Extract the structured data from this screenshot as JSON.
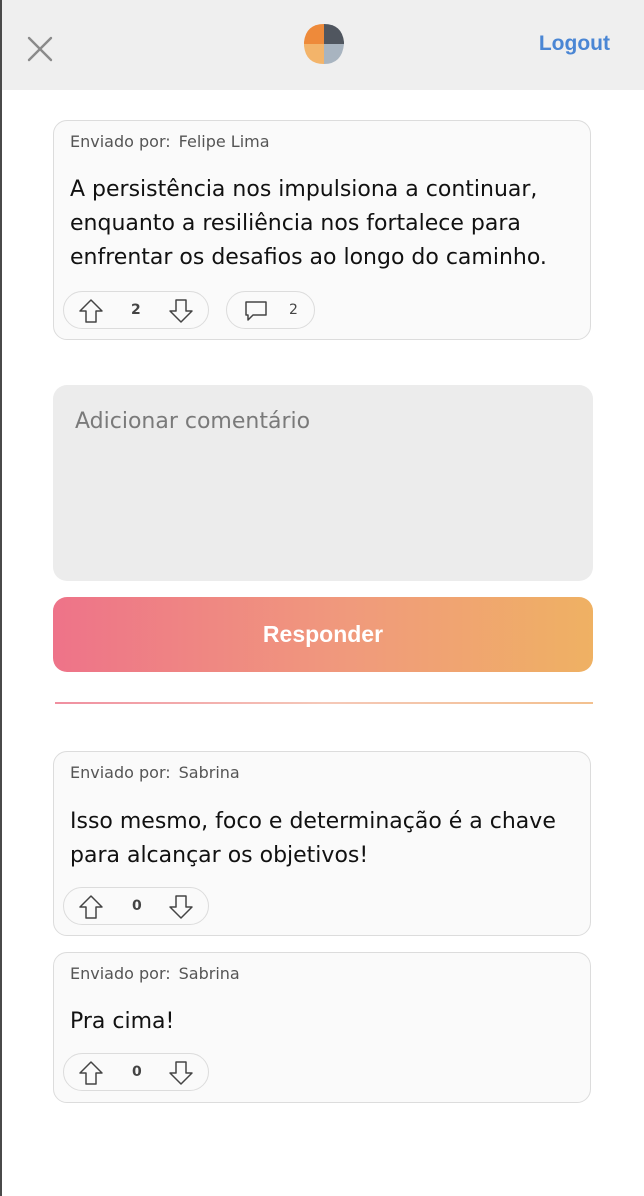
{
  "header": {
    "logout_label": "Logout"
  },
  "post": {
    "sent_by_label": "Enviado por:",
    "author": "Felipe Lima",
    "text": "A persistência nos impulsiona a continuar, enquanto a resiliência nos fortalece para enfrentar os desafios ao longo do caminho.",
    "votes": "2",
    "comments": "2"
  },
  "composer": {
    "placeholder": "Adicionar comentário",
    "reply_label": "Responder"
  },
  "replies": [
    {
      "sent_by_label": "Enviado por:",
      "author": "Sabrina",
      "text": "Isso mesmo, foco e determinação é a chave para alcançar os objetivos!",
      "votes": "0"
    },
    {
      "sent_by_label": "Enviado por:",
      "author": "Sabrina",
      "text": "Pra cima!",
      "votes": "0"
    }
  ],
  "colors": {
    "accent_link": "#4a86d4",
    "button_gradient_start": "#ee7389",
    "button_gradient_end": "#efb163"
  },
  "icons": [
    "close-icon",
    "app-logo",
    "upvote-arrow-icon",
    "downvote-arrow-icon",
    "comment-bubble-icon"
  ]
}
